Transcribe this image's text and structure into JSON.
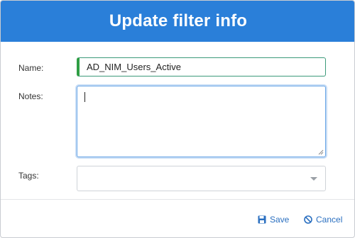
{
  "dialog": {
    "title": "Update filter info"
  },
  "form": {
    "name_label": "Name:",
    "name_value": "AD_NIM_Users_Active",
    "notes_label": "Notes:",
    "notes_value": "",
    "tags_label": "Tags:",
    "tags_value": ""
  },
  "footer": {
    "save_label": "Save",
    "cancel_label": "Cancel"
  },
  "colors": {
    "header_bg": "#2a7fd9",
    "valid_accent": "#2f9e44",
    "focus_border": "#6aa6e6",
    "link": "#2a6fc0"
  },
  "icons": {
    "save": "floppy-disk-icon",
    "cancel": "ban-circle-icon",
    "tags_dropdown": "caret-down-icon"
  }
}
